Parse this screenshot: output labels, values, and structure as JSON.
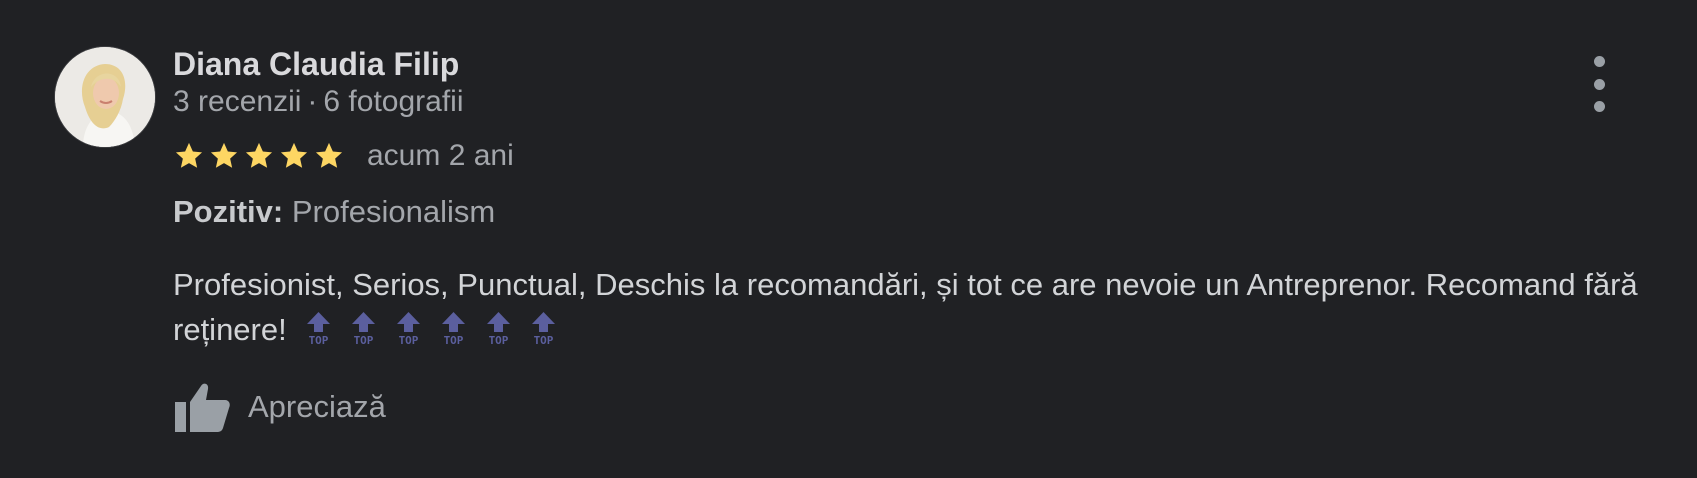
{
  "review": {
    "author": {
      "name": "Diana Claudia Filip",
      "reviews": "3 recenzii",
      "separator": "·",
      "photos": "6 fotografii"
    },
    "rating": 5,
    "time": "acum 2 ani",
    "attribute": {
      "label": "Pozitiv:",
      "value": "Profesionalism"
    },
    "text": "Profesionist, Serios, Punctual, Deschis la recomandări, și tot ce are nevoie un Antreprenor. Recomand fără reținere!",
    "emoji_count": 6,
    "emoji_label": "TOP",
    "like_label": "Apreciază"
  },
  "colors": {
    "background": "#202124",
    "star": "#fdd663",
    "emoji": "#5b5f9e",
    "icon": "#9aa0a6"
  },
  "icons": {
    "avatar": "user-photo",
    "star": "star-icon",
    "emoji": "top-arrow-emoji",
    "like": "thumbs-up-icon",
    "more": "more-vertical-icon"
  }
}
